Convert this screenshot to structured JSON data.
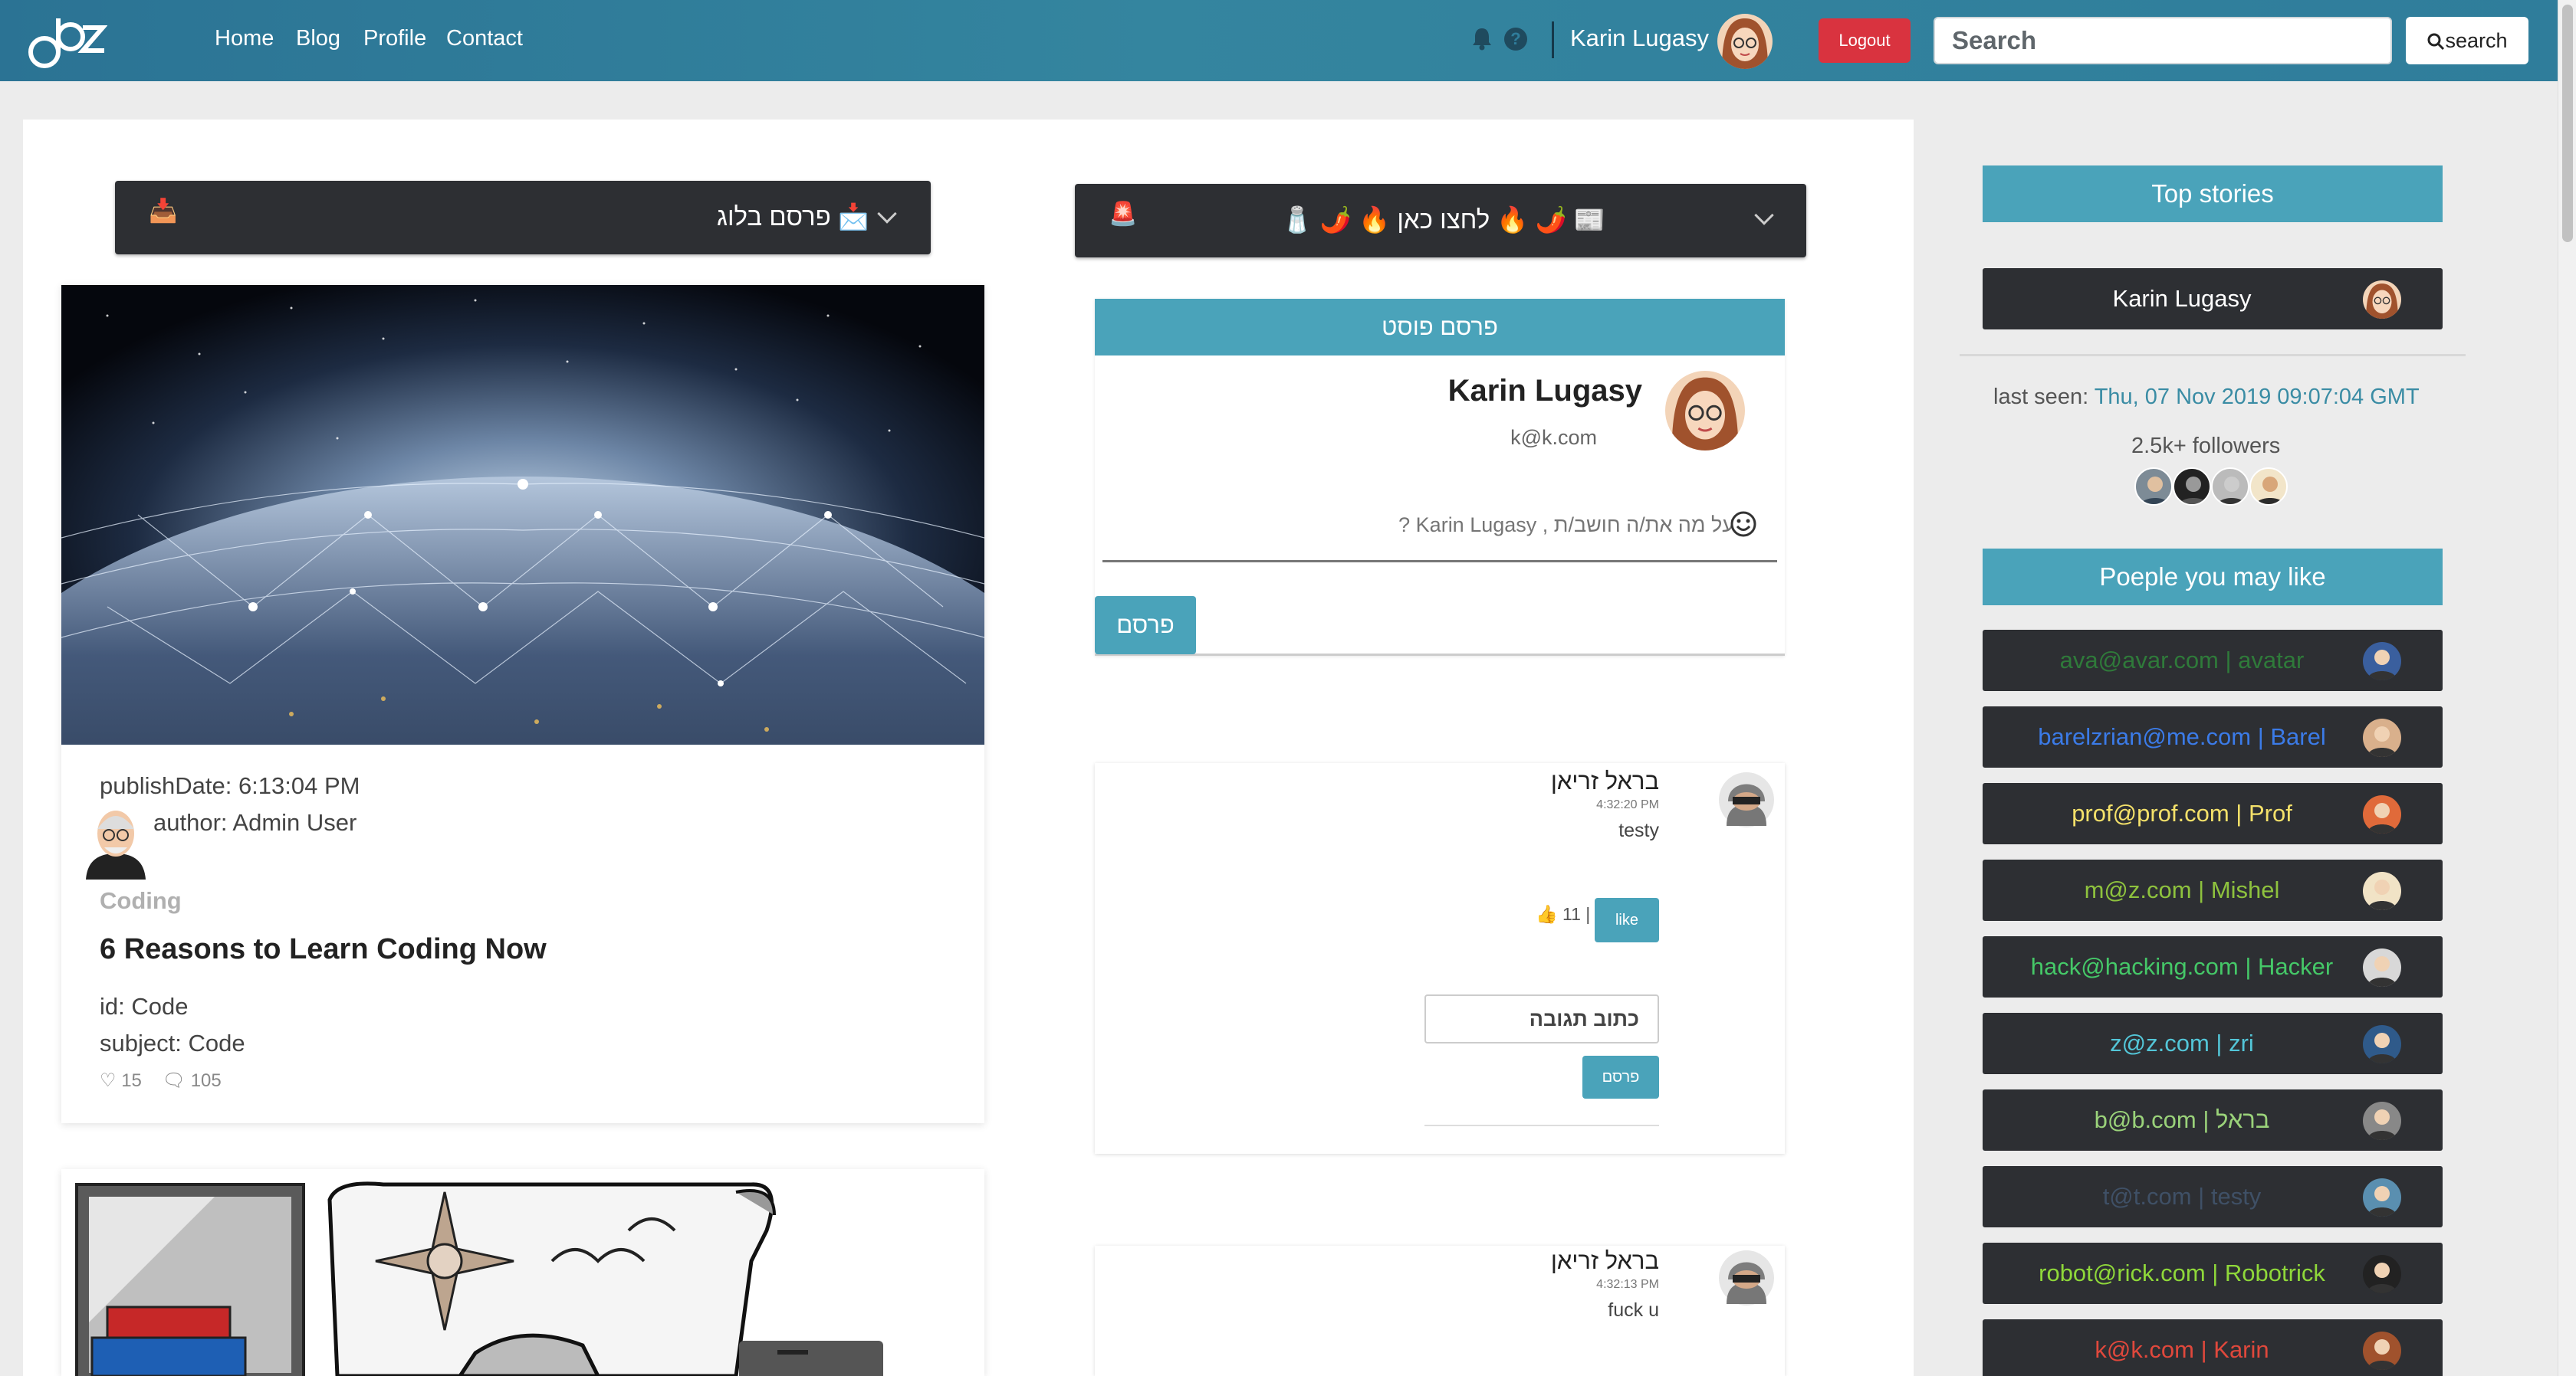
{
  "navbar": {
    "links": [
      "Home",
      "Blog",
      "Profile",
      "Contact"
    ],
    "user_name": "Karin Lugasy",
    "logout_label": "Logout",
    "search_placeholder": "Search",
    "search_button_label": "search",
    "icons": [
      "logo-icon",
      "bell-icon",
      "help-icon",
      "avatar"
    ]
  },
  "blog_bar": {
    "emoji_left": "📥",
    "text": "📩 פרסם בלוג"
  },
  "hot_bar": {
    "emoji_left": "🚨",
    "text": "📰 🌶️ 🔥 לחצו כאן 🔥 🌶️ 🧂"
  },
  "blog_card": {
    "publish_date": "publishDate: 6:13:04 PM",
    "author": "author: Admin User",
    "category": "Coding",
    "title": "6 Reasons to Learn Coding Now",
    "id": "id: Code",
    "subject": "subject: Code",
    "likes": "15",
    "comments": "105"
  },
  "composer": {
    "header": "פרסם פוסט",
    "name": "Karin Lugasy",
    "email": "k@k.com",
    "placeholder": "על מה את/ה חושב/ת , Karin Lugasy ?",
    "publish_label": "פרסם"
  },
  "posts": [
    {
      "author": "בראל זריאן",
      "time": "4:32:20 PM",
      "text": "testy",
      "like_count": "👍 11 |",
      "like_label": "like",
      "comment_placeholder": "כתוב תגובה",
      "comment_button": "פרסם"
    },
    {
      "author": "בראל זריאן",
      "time": "4:32:13 PM",
      "text": "fuck u"
    }
  ],
  "sidebar": {
    "top_stories_title": "Top stories",
    "top_story_name": "Karin Lugasy",
    "last_seen_label": "last seen:",
    "last_seen_date": "Thu, 07 Nov 2019 09:07:04 GMT",
    "followers": "2.5k+ followers",
    "people_title": "Poeple you may like",
    "people": [
      {
        "label": "ava@avar.com | avatar",
        "color": "#2f7a3a"
      },
      {
        "label": "barelzrian@me.com | Barel",
        "color": "#3b7be8"
      },
      {
        "label": "prof@prof.com | Prof",
        "color": "#f4e16a"
      },
      {
        "label": "m@z.com | Mishel",
        "color": "#8ec23e"
      },
      {
        "label": "hack@hacking.com | Hacker",
        "color": "#45c868"
      },
      {
        "label": "z@z.com | zri",
        "color": "#53c6d8"
      },
      {
        "label": "b@b.com | בראל",
        "color": "#9ad27a"
      },
      {
        "label": "t@t.com | testy",
        "color": "#3f5066"
      },
      {
        "label": "robot@rick.com | Robotrick",
        "color": "#8fd83a"
      },
      {
        "label": "k@k.com | Karin",
        "color": "#e0483c"
      }
    ]
  }
}
